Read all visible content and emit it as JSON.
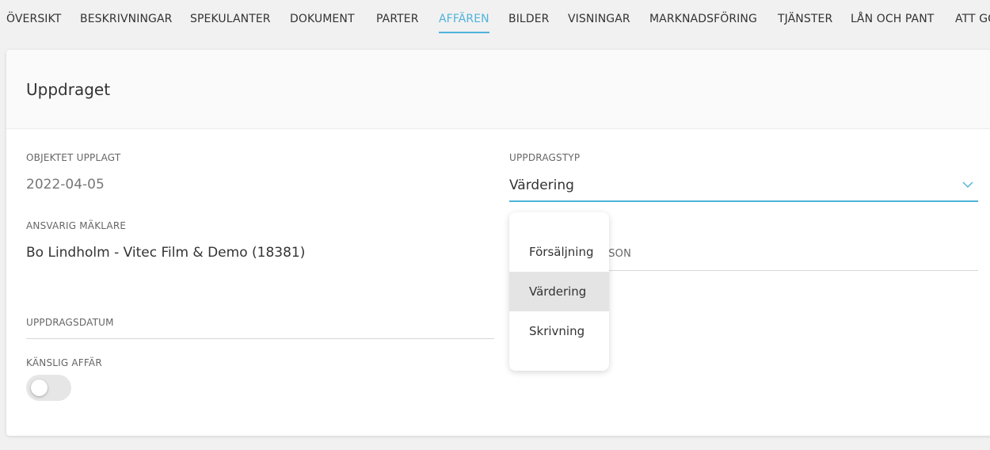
{
  "nav": {
    "tabs": [
      {
        "label": "ÖVERSIKT"
      },
      {
        "label": "BESKRIVNINGAR"
      },
      {
        "label": "SPEKULANTER"
      },
      {
        "label": "DOKUMENT"
      },
      {
        "label": "PARTER"
      },
      {
        "label": "AFFÄREN",
        "active": true
      },
      {
        "label": "BILDER"
      },
      {
        "label": "VISNINGAR"
      },
      {
        "label": "MARKNADSFÖRING"
      },
      {
        "label": "TJÄNSTER"
      },
      {
        "label": "LÅN OCH PANT"
      },
      {
        "label": "ATT GÖRA"
      }
    ],
    "accent_color": "#4fb3d9"
  },
  "card": {
    "title": "Uppdraget",
    "fields": {
      "objekt_upplagt": {
        "label": "OBJEKTET UPPLAGT",
        "value": "2022-04-05"
      },
      "ansvarig": {
        "label": "ANSVARIG MÄKLARE",
        "value": "Bo Lindholm - Vitec Film & Demo (18381)"
      },
      "uppdragsdatum": {
        "label": "UPPDRAGSDATUM",
        "value": ""
      },
      "kanslig": {
        "label": "KÄNSLIG AFFÄR",
        "on": false
      },
      "uppdragstyp": {
        "label": "UPPDRAGSTYP",
        "value": "Värdering",
        "icon": "chevron-down-icon"
      },
      "hidden_field": {
        "label_fragment": "RSON"
      }
    }
  },
  "dropdown": {
    "options": [
      {
        "label": "Försäljning",
        "selected": false
      },
      {
        "label": "Värdering",
        "selected": true
      },
      {
        "label": "Skrivning",
        "selected": false
      }
    ]
  }
}
